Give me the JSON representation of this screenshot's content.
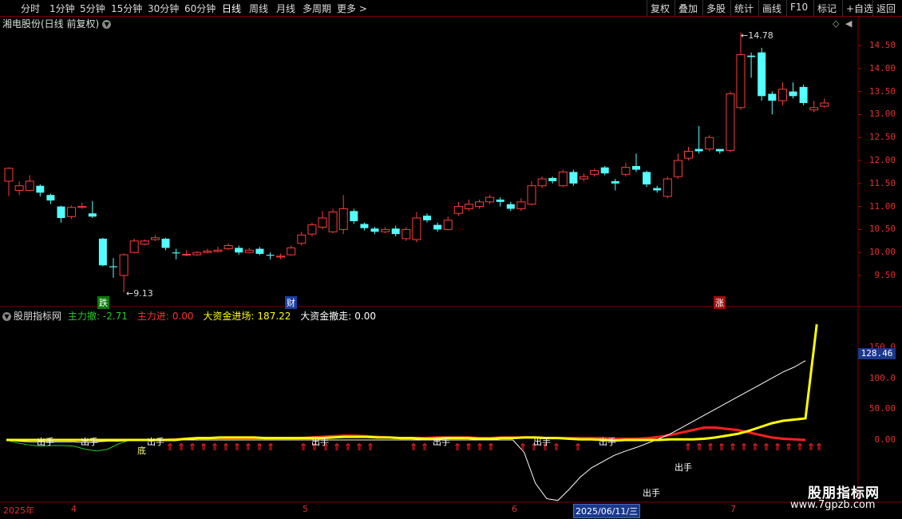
{
  "toolbar": {
    "periods": [
      "分时",
      "1分钟",
      "5分钟",
      "15分钟",
      "30分钟",
      "60分钟",
      "日线",
      "周线",
      "月线",
      "多周期",
      "更多"
    ],
    "more_arrow": ">",
    "active_period": "日线",
    "right_buttons": [
      "复权",
      "叠加",
      "多股",
      "统计",
      "画线",
      "F10",
      "标记",
      "+自选",
      "返回"
    ]
  },
  "main_chart": {
    "title": "湘电股份(日线 前复权)",
    "price_ticks": [
      "14.50",
      "14.00",
      "13.50",
      "13.00",
      "12.50",
      "12.00",
      "11.50",
      "11.00",
      "10.50",
      "10.00",
      "9.50"
    ],
    "high_label": "14.78",
    "low_label": "9.13",
    "badges": [
      {
        "text": "跌",
        "color": "#0a7a0a"
      },
      {
        "text": "财",
        "color": "#1a3fa0"
      },
      {
        "text": "涨",
        "color": "#a01010"
      }
    ]
  },
  "indicator": {
    "name": "股朋指标网",
    "items": [
      {
        "label": "主力撤:",
        "value": "-2.71",
        "color": "#22cc22"
      },
      {
        "label": "主力进:",
        "value": "0.00",
        "color": "#ff3030"
      },
      {
        "label": "大资金进场:",
        "value": "187.22",
        "color": "#ffff00"
      },
      {
        "label": "大资金撤走:",
        "value": "0.00",
        "color": "#ffffff"
      }
    ],
    "ticks": [
      "150.0",
      "100.0",
      "50.00",
      "0.00"
    ],
    "current_value": "128.46",
    "signal_text": "出手",
    "bottom_text": "底"
  },
  "x_axis": {
    "labels": [
      "2025年",
      "4",
      "5",
      "6",
      "7"
    ],
    "cursor_date": "2025/06/11/三"
  },
  "watermark": {
    "name": "股朋指标网",
    "url": "www.7gpzb.com"
  },
  "chart_data": {
    "type": "candlestick",
    "price_range": [
      9.0,
      14.9
    ],
    "indicator_range": [
      -100,
      190
    ],
    "candles": [
      [
        11.55,
        11.83,
        11.23,
        11.85
      ],
      [
        11.35,
        11.45,
        11.25,
        11.55
      ],
      [
        11.35,
        11.55,
        11.33,
        11.68
      ],
      [
        11.45,
        11.3,
        11.22,
        11.48
      ],
      [
        11.25,
        11.13,
        11.05,
        11.28
      ],
      [
        11.0,
        10.75,
        10.65,
        11.02
      ],
      [
        10.78,
        10.98,
        10.73,
        11.02
      ],
      [
        10.98,
        11.0,
        10.95,
        11.08
      ],
      [
        10.85,
        10.78,
        10.75,
        11.12
      ],
      [
        10.3,
        9.72,
        9.7,
        10.32
      ],
      [
        9.7,
        9.68,
        9.45,
        9.88
      ],
      [
        9.5,
        9.95,
        9.13,
        9.98
      ],
      [
        10.0,
        10.25,
        9.98,
        10.3
      ],
      [
        10.18,
        10.25,
        10.15,
        10.28
      ],
      [
        10.28,
        10.32,
        10.25,
        10.38
      ],
      [
        10.3,
        10.1,
        10.05,
        10.32
      ],
      [
        10.0,
        9.98,
        9.85,
        10.08
      ],
      [
        9.95,
        9.96,
        9.92,
        10.05
      ],
      [
        9.95,
        10.0,
        9.93,
        10.03
      ],
      [
        10.0,
        10.03,
        9.98,
        10.08
      ],
      [
        10.02,
        10.05,
        10.0,
        10.12
      ],
      [
        10.08,
        10.15,
        10.05,
        10.2
      ],
      [
        10.1,
        10.0,
        9.95,
        10.15
      ],
      [
        10.0,
        10.05,
        9.98,
        10.1
      ],
      [
        10.08,
        9.97,
        9.94,
        10.12
      ],
      [
        9.95,
        9.93,
        9.85,
        10.0
      ],
      [
        9.9,
        9.92,
        9.85,
        9.98
      ],
      [
        9.95,
        10.1,
        9.93,
        10.15
      ],
      [
        10.2,
        10.38,
        10.15,
        10.45
      ],
      [
        10.4,
        10.6,
        10.35,
        10.65
      ],
      [
        10.55,
        10.75,
        10.5,
        10.9
      ],
      [
        10.45,
        10.88,
        10.42,
        10.95
      ],
      [
        10.5,
        10.95,
        10.4,
        11.25
      ],
      [
        10.9,
        10.68,
        10.62,
        10.95
      ],
      [
        10.62,
        10.53,
        10.48,
        10.65
      ],
      [
        10.52,
        10.45,
        10.4,
        10.56
      ],
      [
        10.45,
        10.5,
        10.42,
        10.55
      ],
      [
        10.52,
        10.4,
        10.35,
        10.58
      ],
      [
        10.3,
        10.5,
        10.25,
        10.55
      ],
      [
        10.28,
        10.75,
        10.22,
        10.88
      ],
      [
        10.8,
        10.7,
        10.65,
        10.85
      ],
      [
        10.6,
        10.5,
        10.45,
        10.65
      ],
      [
        10.5,
        10.7,
        10.48,
        10.78
      ],
      [
        10.85,
        11.0,
        10.8,
        11.1
      ],
      [
        10.95,
        11.05,
        10.9,
        11.15
      ],
      [
        11.0,
        11.1,
        10.95,
        11.15
      ],
      [
        11.1,
        11.2,
        11.05,
        11.25
      ],
      [
        11.15,
        11.1,
        11.0,
        11.2
      ],
      [
        11.05,
        10.95,
        10.9,
        11.1
      ],
      [
        10.95,
        11.1,
        10.9,
        11.18
      ],
      [
        11.05,
        11.45,
        11.02,
        11.55
      ],
      [
        11.45,
        11.6,
        11.4,
        11.65
      ],
      [
        11.62,
        11.55,
        11.5,
        11.65
      ],
      [
        11.45,
        11.75,
        11.42,
        11.8
      ],
      [
        11.75,
        11.5,
        11.45,
        11.8
      ],
      [
        11.6,
        11.65,
        11.55,
        11.72
      ],
      [
        11.7,
        11.78,
        11.65,
        11.82
      ],
      [
        11.85,
        11.72,
        11.68,
        11.88
      ],
      [
        11.55,
        11.5,
        11.35,
        11.6
      ],
      [
        11.7,
        11.85,
        11.65,
        11.95
      ],
      [
        11.88,
        11.8,
        11.75,
        12.15
      ],
      [
        11.75,
        11.48,
        11.42,
        11.78
      ],
      [
        11.4,
        11.35,
        11.3,
        11.45
      ],
      [
        11.22,
        11.6,
        11.18,
        11.65
      ],
      [
        11.65,
        12.0,
        11.6,
        12.15
      ],
      [
        12.05,
        12.2,
        12.0,
        12.3
      ],
      [
        12.25,
        12.2,
        12.15,
        12.75
      ],
      [
        12.25,
        12.5,
        12.2,
        12.55
      ],
      [
        12.25,
        12.2,
        12.15,
        12.25
      ],
      [
        12.22,
        13.45,
        12.18,
        13.5
      ],
      [
        13.15,
        14.3,
        13.1,
        14.78
      ],
      [
        14.28,
        14.25,
        13.8,
        14.35
      ],
      [
        14.35,
        13.4,
        13.3,
        14.45
      ],
      [
        13.45,
        13.3,
        13.0,
        13.5
      ],
      [
        13.3,
        13.55,
        13.2,
        13.7
      ],
      [
        13.5,
        13.4,
        13.35,
        13.7
      ],
      [
        13.6,
        13.25,
        13.2,
        13.65
      ],
      [
        13.1,
        13.15,
        13.05,
        13.3
      ],
      [
        13.18,
        13.25,
        13.15,
        13.35
      ]
    ],
    "indicator_series": {
      "yellow": [
        0,
        0,
        0,
        0,
        0,
        0,
        0,
        0,
        0,
        0,
        0,
        0,
        0,
        0,
        0,
        0,
        2,
        3,
        3,
        4,
        4,
        4,
        4,
        3,
        3,
        3,
        3,
        3,
        3,
        4,
        5,
        5,
        5,
        4,
        4,
        3,
        3,
        2,
        2,
        3,
        3,
        3,
        2,
        2,
        3,
        3,
        4,
        4,
        3,
        3,
        2,
        1,
        1,
        0,
        -1,
        0,
        0,
        0,
        0,
        1,
        1,
        1,
        2,
        4,
        7,
        10,
        15,
        21,
        27,
        31,
        33,
        35,
        187.22
      ],
      "white": [
        0,
        -2,
        -3,
        -3,
        -3,
        -3,
        -3,
        -4,
        -3,
        -2,
        -2,
        -1,
        0,
        0,
        0,
        0,
        0,
        0,
        0,
        0,
        0,
        0,
        0,
        0,
        0,
        0,
        0,
        0,
        0,
        0,
        0,
        0,
        0,
        0,
        0,
        0,
        0,
        0,
        0,
        0,
        0,
        0,
        0,
        0,
        0,
        0,
        -20,
        -70,
        -95,
        -98,
        -80,
        -60,
        -45,
        -35,
        -25,
        -18,
        -12,
        -5,
        2,
        10,
        20,
        30,
        40,
        50,
        60,
        70,
        80,
        90,
        100,
        110,
        118,
        128.46
      ],
      "red": [
        0,
        0,
        0,
        0,
        0,
        0,
        0,
        0,
        0,
        0,
        0,
        0,
        0,
        0,
        0,
        1,
        2,
        3,
        3,
        3,
        3,
        3,
        3,
        3,
        3,
        3,
        3,
        4,
        5,
        6,
        7,
        7,
        6,
        5,
        4,
        3,
        3,
        3,
        4,
        4,
        4,
        4,
        3,
        3,
        4,
        4,
        4,
        4,
        3,
        3,
        3,
        3,
        3,
        3,
        2,
        2,
        2,
        3,
        5,
        8,
        12,
        16,
        20,
        20,
        18,
        16,
        12,
        8,
        4,
        2,
        1,
        0
      ],
      "green": [
        0,
        -5,
        -8,
        -10,
        -9,
        -9,
        -10,
        -15,
        -18,
        -15,
        -6,
        0
      ]
    }
  }
}
